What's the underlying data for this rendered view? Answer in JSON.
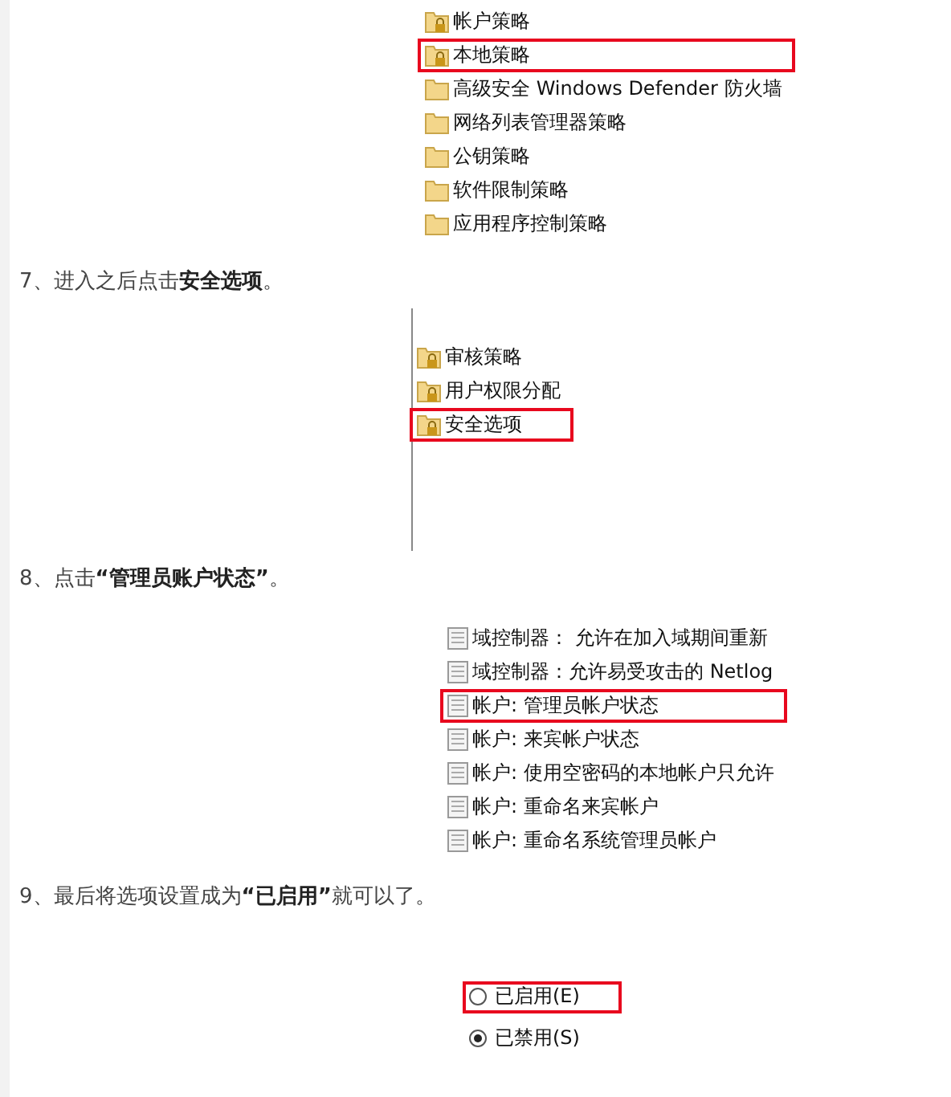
{
  "blocks": [
    {
      "kind": "folders",
      "items": [
        {
          "label": "帐户策略",
          "locked": true,
          "highlighted": false
        },
        {
          "label": "本地策略",
          "locked": true,
          "highlighted": true
        },
        {
          "label": "高级安全 Windows Defender 防火墙",
          "locked": false,
          "highlighted": false
        },
        {
          "label": "网络列表管理器策略",
          "locked": false,
          "highlighted": false
        },
        {
          "label": "公钥策略",
          "locked": false,
          "highlighted": false
        },
        {
          "label": "软件限制策略",
          "locked": false,
          "highlighted": false
        },
        {
          "label": "应用程序控制策略",
          "locked": false,
          "highlighted": false
        }
      ]
    },
    {
      "kind": "text",
      "text": "7、进入之后点击**安全选项**。"
    },
    {
      "kind": "folders",
      "items": [
        {
          "label": "审核策略",
          "locked": true,
          "highlighted": false
        },
        {
          "label": "用户权限分配",
          "locked": true,
          "highlighted": false
        },
        {
          "label": "安全选项",
          "locked": true,
          "highlighted": true
        }
      ]
    },
    {
      "kind": "text",
      "text": "8、点击**“管理员账户状态”**。"
    },
    {
      "kind": "policies",
      "items": [
        {
          "label": "域控制器： 允许在加入域期间重新",
          "highlighted": false
        },
        {
          "label": "域控制器：允许易受攻击的 Netlog",
          "highlighted": false
        },
        {
          "label": "帐户: 管理员帐户状态",
          "highlighted": true
        },
        {
          "label": "帐户: 来宾帐户状态",
          "highlighted": false
        },
        {
          "label": "帐户: 使用空密码的本地帐户只允许",
          "highlighted": false
        },
        {
          "label": "帐户: 重命名来宾帐户",
          "highlighted": false
        },
        {
          "label": "帐户: 重命名系统管理员帐户",
          "highlighted": false
        }
      ]
    },
    {
      "kind": "text",
      "text": "9、最后将选项设置成为**“已启用”**就可以了。"
    },
    {
      "kind": "radios",
      "items": [
        {
          "label": "已启用(E)",
          "selected": false,
          "highlighted": true
        },
        {
          "label": "已禁用(S)",
          "selected": true,
          "highlighted": false
        }
      ]
    }
  ]
}
